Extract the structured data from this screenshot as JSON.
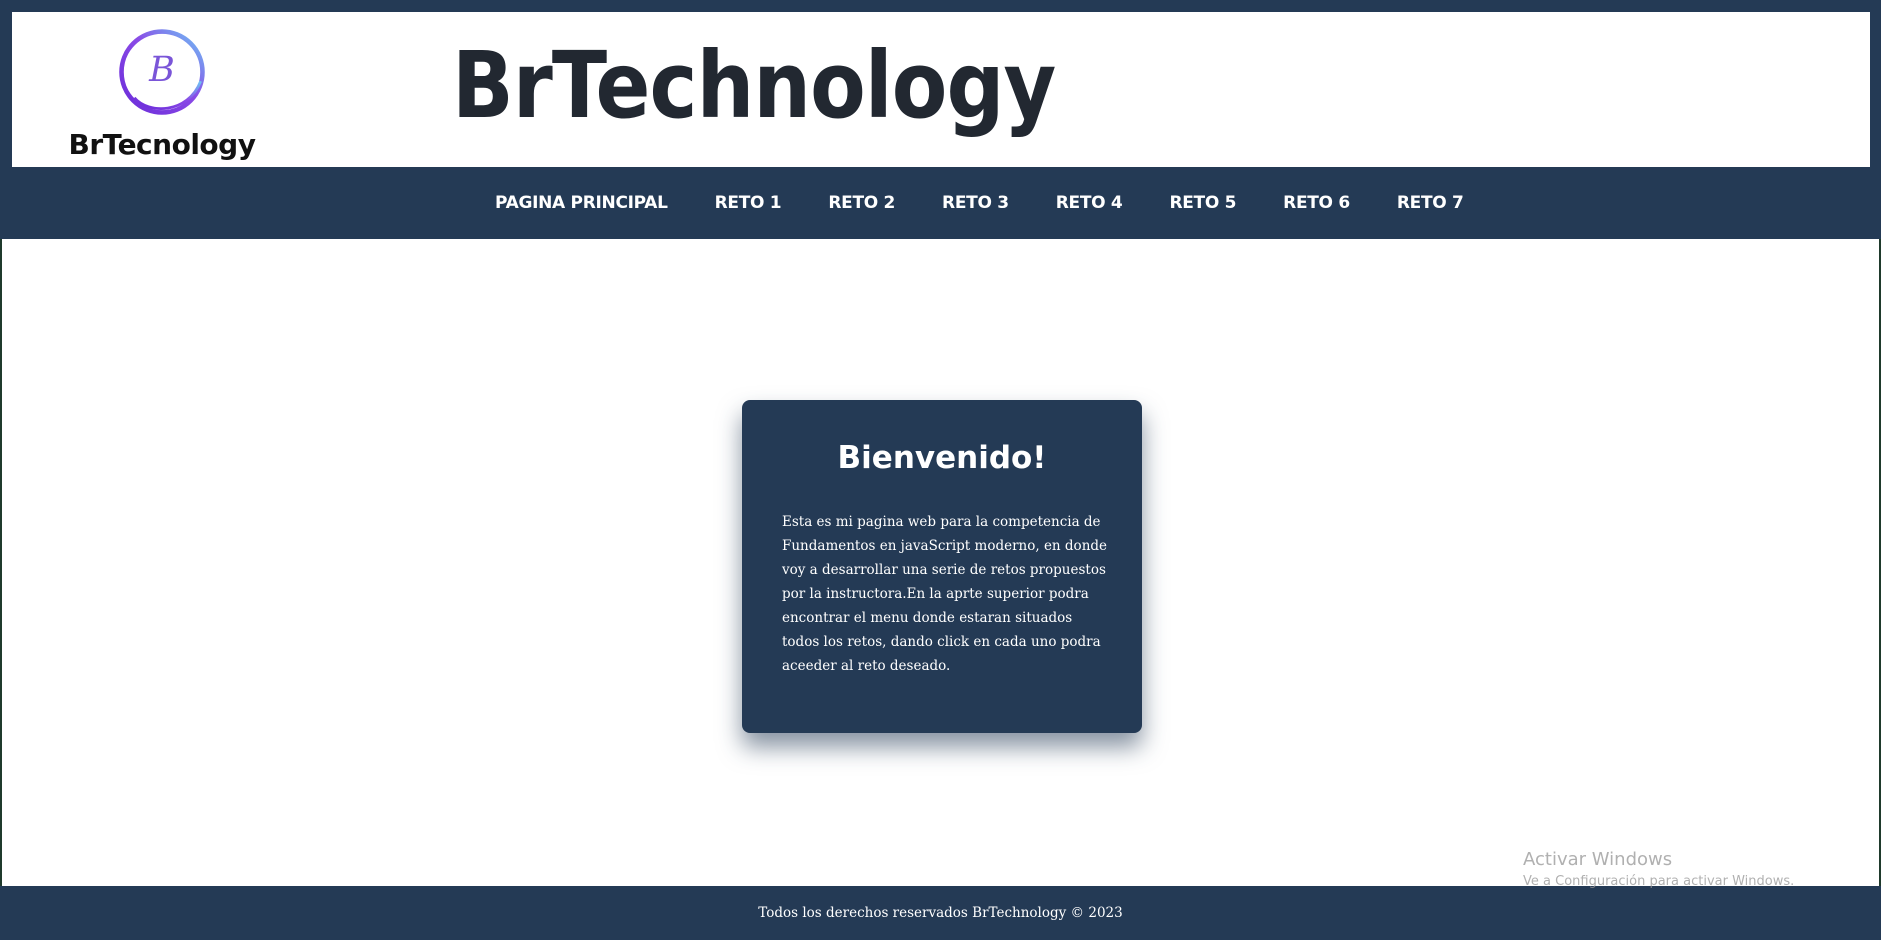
{
  "header": {
    "logo_text": "BrTecnology",
    "logo_letter": "B",
    "site_title": "BrTechnology"
  },
  "nav": {
    "items": [
      {
        "label": "PAGINA PRINCIPAL"
      },
      {
        "label": "RETO 1"
      },
      {
        "label": "RETO 2"
      },
      {
        "label": "RETO 3"
      },
      {
        "label": "RETO 4"
      },
      {
        "label": "RETO 5"
      },
      {
        "label": "RETO 6"
      },
      {
        "label": "RETO 7"
      }
    ]
  },
  "card": {
    "title": "Bienvenido!",
    "body": "Esta es mi pagina web para la competencia de Fundamentos en javaScript moderno, en donde voy a desarrollar una serie de retos propuestos por la instructora.En la aprte superior podra encontrar el menu donde estaran situados todos los retos, dando click en cada uno podra aceeder al reto deseado."
  },
  "footer": {
    "text": "Todos los derechos reservados BrTechnology © 2023"
  },
  "watermark": {
    "title": "Activar Windows",
    "subtitle": "Ve a Configuración para activar Windows."
  },
  "colors": {
    "primary": "#243a55",
    "logo_gradient_start": "#6a2bd9",
    "logo_gradient_end": "#6ec6f5"
  }
}
